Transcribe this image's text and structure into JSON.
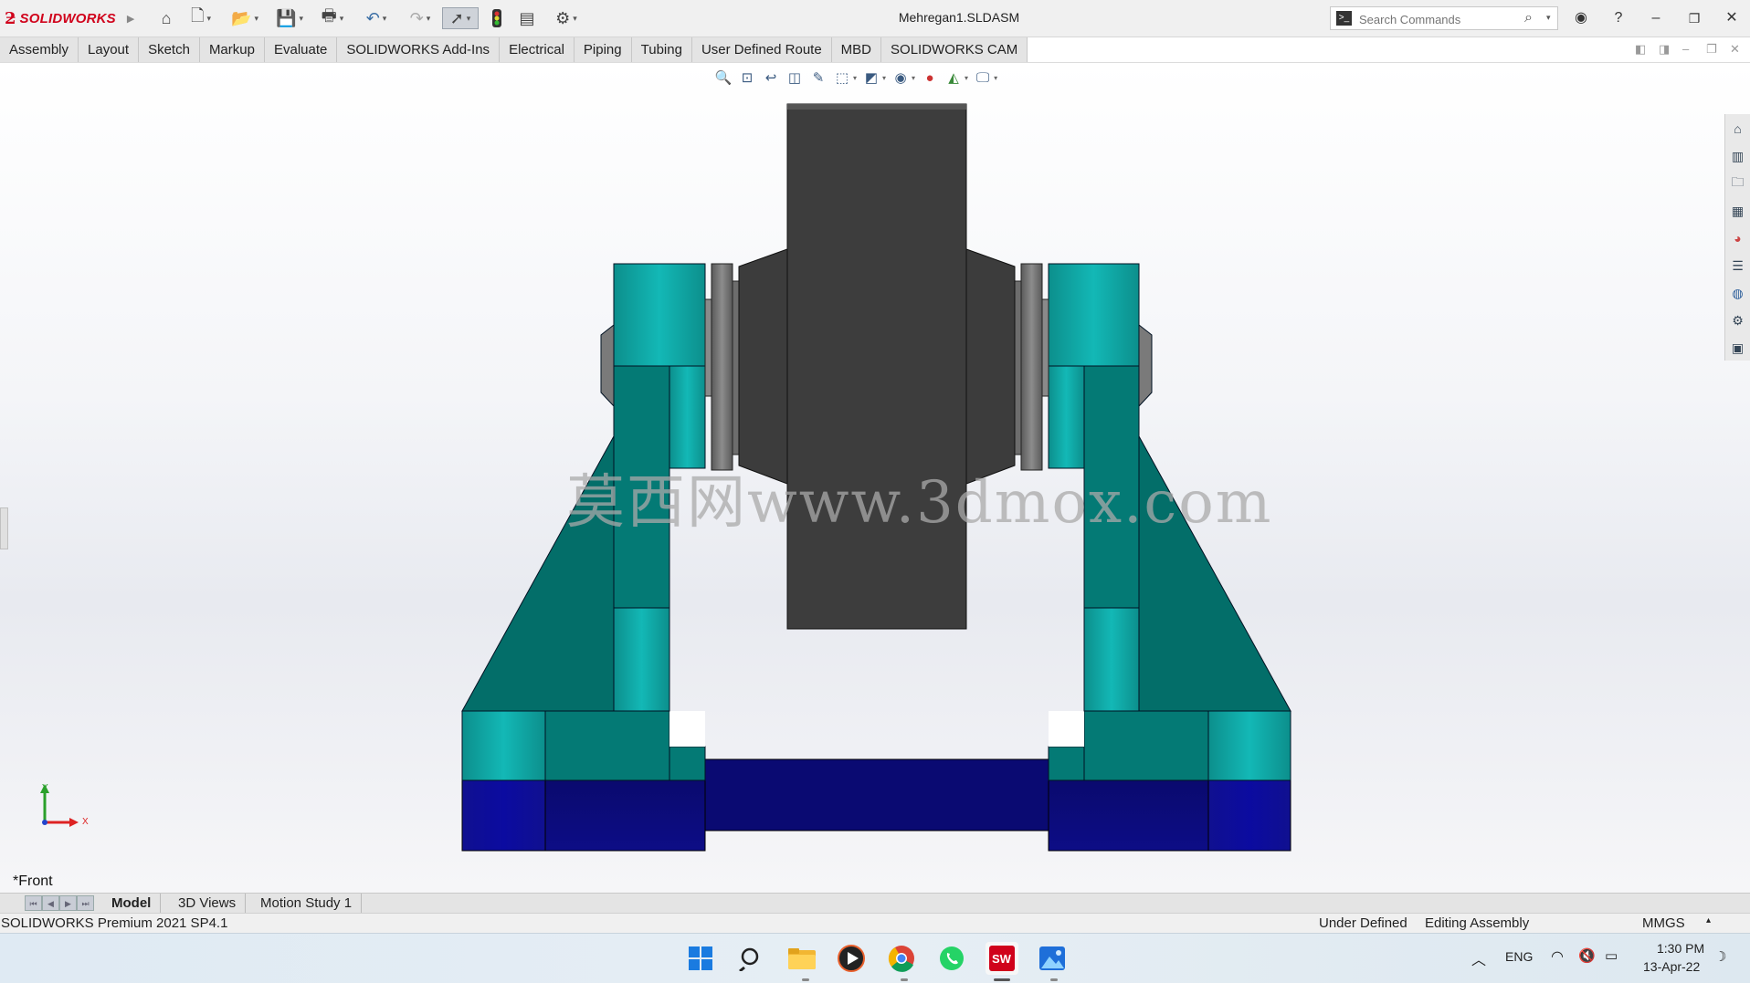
{
  "app": {
    "logo_text": "SOLIDWORKS",
    "document_title": "Mehregan1.SLDASM"
  },
  "search": {
    "placeholder": "Search Commands"
  },
  "menu_tabs": [
    "Assembly",
    "Layout",
    "Sketch",
    "Markup",
    "Evaluate",
    "SOLIDWORKS Add-Ins",
    "Electrical",
    "Piping",
    "Tubing",
    "User Defined Route",
    "MBD",
    "SOLIDWORKS CAM"
  ],
  "quick_access_icons": [
    "home-icon",
    "new-document-icon",
    "open-icon",
    "save-icon",
    "print-icon",
    "undo-icon",
    "redo-icon",
    "select-icon",
    "traffic-light-icon",
    "file-properties-icon",
    "options-gear-icon"
  ],
  "viewport": {
    "watermark": "莫西网www.3dmox.com",
    "view_name": "*Front",
    "triad": {
      "y": "Y",
      "x": "X"
    },
    "colors": {
      "teal_light": "#0fa7a6",
      "teal": "#047a75",
      "teal_dark": "#036a66",
      "navy": "#0b0b7a",
      "dark_block": "#3b3b3b",
      "gray_ring": "#707070"
    }
  },
  "bottom_tabs": [
    "Model",
    "3D Views",
    "Motion Study 1"
  ],
  "status": {
    "product": "SOLIDWORKS Premium 2021 SP4.1",
    "definition": "Under Defined",
    "mode": "Editing Assembly",
    "units": "MMGS"
  },
  "taskbar": {
    "lang": "ENG",
    "time": "1:30 PM",
    "date": "13-Apr-22"
  }
}
